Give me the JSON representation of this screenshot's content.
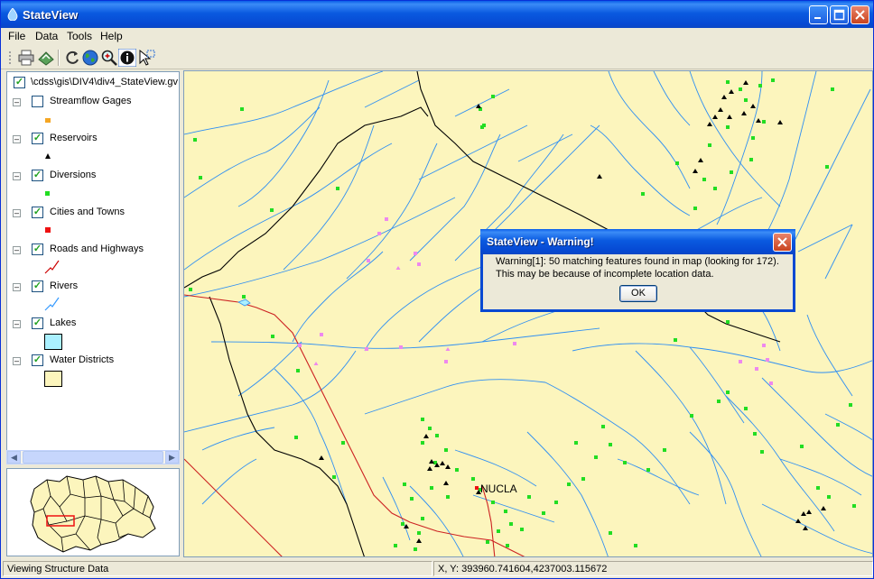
{
  "window": {
    "title": "StateView",
    "minimize_icon": "minimize-icon",
    "maximize_icon": "maximize-icon",
    "close_icon": "close-icon"
  },
  "menu": [
    "File",
    "Data",
    "Tools",
    "Help"
  ],
  "toolbar": {
    "icons": [
      "print-icon",
      "export-icon",
      "refresh-icon",
      "globe-icon",
      "zoom-icon",
      "info-icon",
      "select-icon"
    ]
  },
  "legend": {
    "root_label": "\\cdss\\gis\\DIV4\\div4_StateView.gv",
    "layers": [
      {
        "label": "Streamflow Gages",
        "checked": false
      },
      {
        "label": "Reservoirs",
        "checked": true
      },
      {
        "label": "Diversions",
        "checked": true
      },
      {
        "label": "Cities and Towns",
        "checked": true
      },
      {
        "label": "Roads and Highways",
        "checked": true
      },
      {
        "label": "Rivers",
        "checked": true
      },
      {
        "label": "Lakes",
        "checked": true
      },
      {
        "label": "Water Districts",
        "checked": true
      }
    ],
    "colors": {
      "streamflow": "#f5a623",
      "reservoir": "#000000",
      "diversion": "#22dd22",
      "city": "#ee1111",
      "road": "#cc0000",
      "river": "#3399ff",
      "lake": "#aaf0ff",
      "district": "#fcf5bd"
    }
  },
  "map": {
    "town_label": "NUCLA",
    "colors": {
      "background": "#fcf5bd",
      "river": "#2f8ff2",
      "boundary": "#000000",
      "road": "#cc2222",
      "diversion": "#22dd22",
      "structure": "#ee88ee"
    }
  },
  "dialog": {
    "title": "StateView - Warning!",
    "line1": "Warning[1]: 50 matching features found in map (looking for 172).",
    "line2": "This may be because of incomplete location data.",
    "ok_label": "OK"
  },
  "status": {
    "message": "Viewing Structure Data",
    "coords": "X, Y:  393960.741604,4237003.115672"
  }
}
